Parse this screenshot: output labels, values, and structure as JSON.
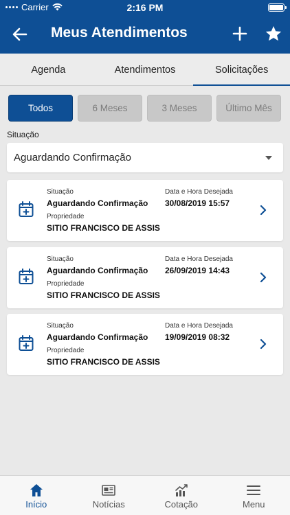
{
  "status_bar": {
    "carrier": "Carrier",
    "time": "2:16 PM"
  },
  "header": {
    "title": "Meus Atendimentos",
    "back_icon": "back-arrow-icon",
    "add_icon": "plus-icon",
    "favorite_icon": "star-icon"
  },
  "tabs": [
    {
      "label": "Agenda",
      "active": false
    },
    {
      "label": "Atendimentos",
      "active": false
    },
    {
      "label": "Solicitações",
      "active": true
    }
  ],
  "filters": [
    {
      "label": "Todos",
      "active": true
    },
    {
      "label": "6 Meses",
      "active": false
    },
    {
      "label": "3 Meses",
      "active": false
    },
    {
      "label": "Último Mês",
      "active": false
    }
  ],
  "situacao": {
    "label": "Situação",
    "selected": "Aguardando Confirmação"
  },
  "requests": [
    {
      "situacao_label": "Situação",
      "situacao": "Aguardando Confirmação",
      "data_label": "Data e Hora Desejada",
      "data": "30/08/2019 15:57",
      "propriedade_label": "Propriedade",
      "propriedade": "SITIO FRANCISCO DE ASSIS"
    },
    {
      "situacao_label": "Situação",
      "situacao": "Aguardando Confirmação",
      "data_label": "Data e Hora Desejada",
      "data": "26/09/2019 14:43",
      "propriedade_label": "Propriedade",
      "propriedade": "SITIO FRANCISCO DE ASSIS"
    },
    {
      "situacao_label": "Situação",
      "situacao": "Aguardando Confirmação",
      "data_label": "Data e Hora Desejada",
      "data": "19/09/2019 08:32",
      "propriedade_label": "Propriedade",
      "propriedade": "SITIO FRANCISCO DE ASSIS"
    }
  ],
  "bottom_nav": [
    {
      "label": "Início",
      "icon": "home-icon",
      "active": true
    },
    {
      "label": "Notícias",
      "icon": "newspaper-icon",
      "active": false
    },
    {
      "label": "Cotação",
      "icon": "chart-icon",
      "active": false
    },
    {
      "label": "Menu",
      "icon": "hamburger-menu-icon",
      "active": false
    }
  ],
  "colors": {
    "primary": "#0e4f95",
    "background": "#e9e9e9",
    "inactive_button": "#c8c8c8"
  }
}
